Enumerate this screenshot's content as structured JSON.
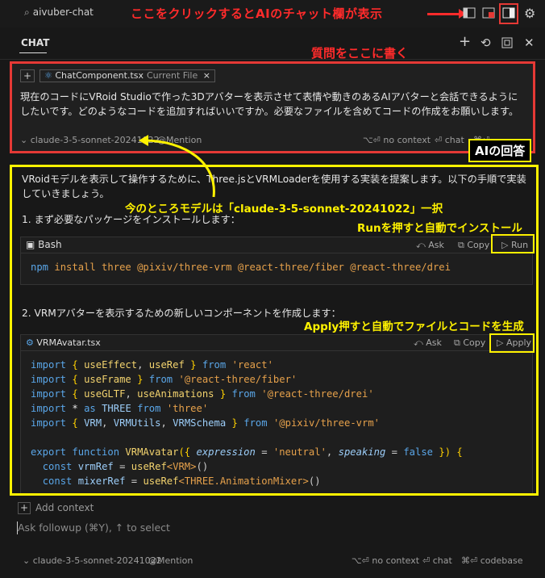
{
  "topbar": {
    "search_text": "aivuber-chat",
    "annotation": "ここをクリックするとAIのチャット欄が表示"
  },
  "header": {
    "title": "CHAT"
  },
  "question": {
    "annotation": "質問をここに書く",
    "file_chip": "ChatComponent.tsx",
    "file_chip_sub": "Current File",
    "text": "現在のコードにVRoid Studioで作った3Dアバターを表示させて表情や動きのあるAIアバターと会話できるようにしたいです。どのようなコードを追加すればいいですか。必要なファイルを含めてコードの作成をお願いします。",
    "model": "claude-3-5-sonnet-20241022",
    "mention": "@Mention",
    "no_context": "⌥⏎ no context",
    "chat": "⏎ chat",
    "codebase": "⌘⏎"
  },
  "answer": {
    "annotation": "AIの回答",
    "intro": "VRoidモデルを表示して操作するために、Three.jsとVRMLoaderを使用する実装を提案します。以下の手順で実装していきましょう。",
    "model_note": "今のところモデルは「claude-3-5-sonnet-20241022」一択",
    "step1": "1. まず必要なパッケージをインストールします：",
    "run_note": "Runを押すと自動でインストール",
    "bash_lang": "Bash",
    "ask": "Ask",
    "copy": "Copy",
    "run": "Run",
    "npm_cmd_kw": "npm",
    "npm_cmd_rest": " install three @pixiv/three-vrm @react-three/fiber @react-three/drei",
    "step2": "2. VRMアバターを表示するための新しいコンポーネントを作成します：",
    "apply_note": "Apply押すと自動でファイルとコードを生成",
    "file_name": "VRMAvatar.tsx",
    "apply": "Apply"
  },
  "composer": {
    "add_context": "Add context",
    "placeholder": "Ask followup (⌘Y), ↑ to select",
    "model": "claude-3-5-sonnet-20241022",
    "mention": "@Mention",
    "no_context": "⌥⏎ no context",
    "chat": "⏎ chat",
    "codebase": "⌘⏎ codebase"
  },
  "colors": {
    "red_annotation": "#ff2b2b",
    "yellow_annotation": "#fff200",
    "keyword": "#5aa6e8",
    "string": "#e6a14b"
  }
}
